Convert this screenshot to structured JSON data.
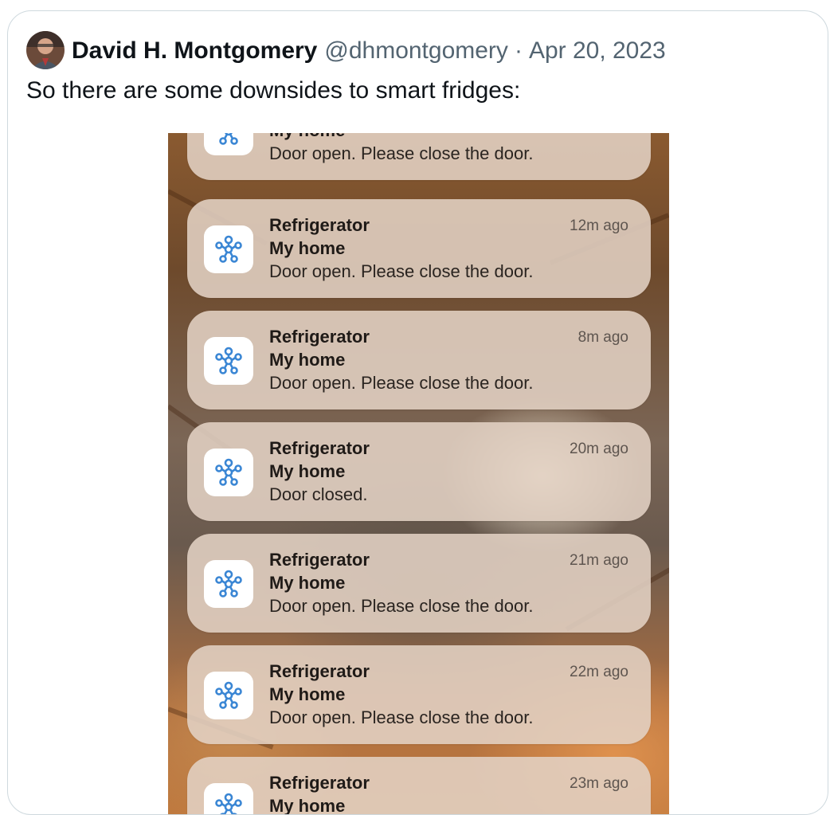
{
  "post": {
    "author_name": "David H. Montgomery",
    "author_handle": "@dhmontgomery",
    "separator": "·",
    "date": "Apr 20, 2023",
    "text": "So there are some downsides to smart fridges:"
  },
  "notifications": [
    {
      "app": "",
      "title": "My home",
      "body": "Door open. Please close the door.",
      "time": ""
    },
    {
      "app": "Refrigerator",
      "title": "My home",
      "body": "Door open. Please close the door.",
      "time": "12m ago"
    },
    {
      "app": "Refrigerator",
      "title": "My home",
      "body": "Door open. Please close the door.",
      "time": "8m ago"
    },
    {
      "app": "Refrigerator",
      "title": "My home",
      "body": "Door closed.",
      "time": "20m ago"
    },
    {
      "app": "Refrigerator",
      "title": "My home",
      "body": "Door open. Please close the door.",
      "time": "21m ago"
    },
    {
      "app": "Refrigerator",
      "title": "My home",
      "body": "Door open. Please close the door.",
      "time": "22m ago"
    },
    {
      "app": "Refrigerator",
      "title": "My home",
      "body": "",
      "time": "23m ago"
    }
  ],
  "icons": {
    "notification_app_icon": "smart-home-hub-icon",
    "notification_icon_color": "#3a86d4"
  },
  "colors": {
    "name": "#0f1419",
    "muted": "#536471",
    "border": "#cfd9de"
  }
}
